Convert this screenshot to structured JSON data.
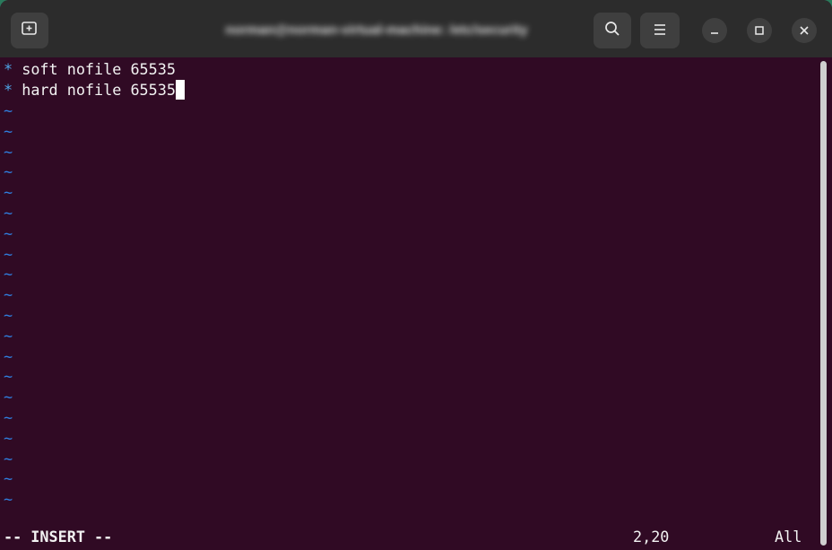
{
  "window": {
    "title": "norman@norman-virtual-machine: /etc/security"
  },
  "icons": {
    "new_tab": "new-tab-icon",
    "search": "search-icon",
    "menu": "hamburger-menu-icon",
    "minimize": "minimize-icon",
    "maximize": "maximize-icon",
    "close": "close-icon"
  },
  "editor": {
    "lines": [
      {
        "prefix": "*",
        "text": " soft nofile 65535"
      },
      {
        "prefix": "*",
        "text": " hard nofile 65535"
      }
    ],
    "tilde": "~",
    "empty_line_count": 20
  },
  "status": {
    "mode": "-- INSERT --",
    "position": "2,20",
    "scroll": "All"
  },
  "colors": {
    "background": "#300a24",
    "titlebar": "#2c2c2c",
    "tilde": "#2f7fe0",
    "text": "#f2f2f2"
  }
}
